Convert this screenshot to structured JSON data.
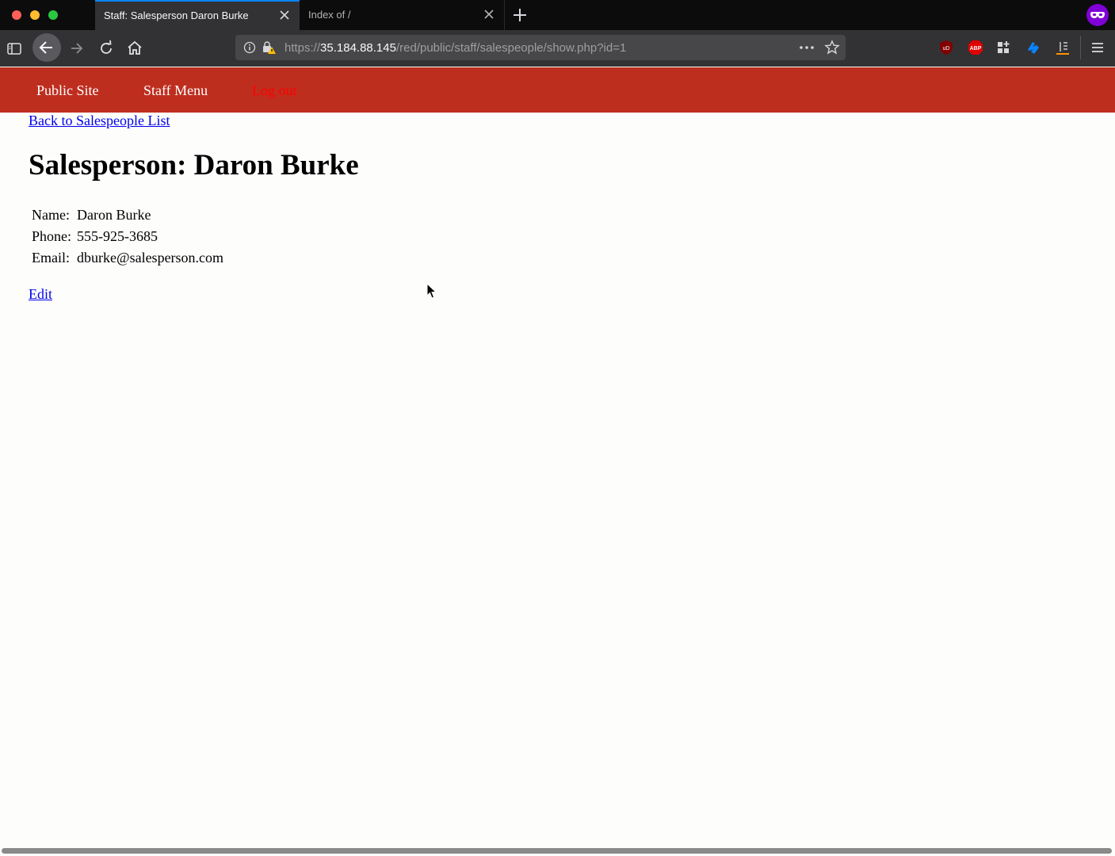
{
  "browser": {
    "tabs": [
      {
        "title": "Staff: Salesperson Daron Burke",
        "active": true
      },
      {
        "title": "Index of /",
        "active": false
      }
    ],
    "url": {
      "scheme": "https://",
      "host": "35.184.88.145",
      "path": "/red/public/staff/salespeople/show.php?id=1"
    },
    "icons": [
      "sidebar-icon",
      "back-icon",
      "forward-icon",
      "reload-icon",
      "home-icon",
      "info-icon",
      "insecure-lock-icon",
      "more-icon",
      "bookmark-star-icon",
      "ublock-icon",
      "adblock-plus-icon",
      "extension-icon",
      "extension-icon",
      "library-icon",
      "menu-icon",
      "private-browsing-icon"
    ]
  },
  "site_nav": {
    "public_site": "Public Site",
    "staff_menu": "Staff Menu",
    "log_out": "Log out"
  },
  "page": {
    "back_link": "Back to Salespeople List",
    "title": "Salesperson: Daron Burke",
    "attributes": [
      {
        "label": "Name:",
        "value": "Daron Burke"
      },
      {
        "label": "Phone:",
        "value": "555-925-3685"
      },
      {
        "label": "Email:",
        "value": "dburke@salesperson.com"
      }
    ],
    "edit_link": "Edit"
  },
  "colors": {
    "site_nav_bg": "#be2e1f",
    "logout_text": "#ff0000",
    "link": "#0000ee",
    "active_tab_accent": "#0a84ff"
  }
}
